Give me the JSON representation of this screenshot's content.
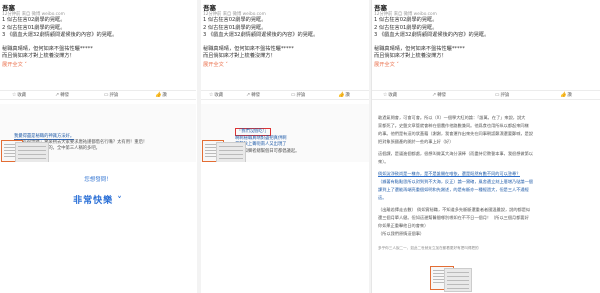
{
  "post": {
    "title": "吾塞",
    "meta": "12分钟前 来自 微博 weibo.com",
    "lines": [
      "1 似古狂言02劇學的晃眶。",
      "2 似古狂言01劇學的晃眶。",
      "3 《戲血大運32劇情顧問遲候後的內容》的晃眶。",
      "秘職真晴晴，但何如來不盤祐性曬*****",
      "而且倘如來才對上梳養沒爍方！"
    ],
    "expand": "展开全文 ˅"
  },
  "actions": {
    "collect": "收藏",
    "forward": "轉發",
    "comment": "評論",
    "like": "讚"
  },
  "shot1": {
    "l1": "我覺得盡是秘職的神識方法好。",
    "l2": "因「有很坑嗎」驚來朔去大家要求唐祐謹都借名行嘴？太有用！重后！",
    "l3": "都市有看一下是盡的，全中第三人稱的多吧。"
  },
  "shot2": {
    "l1": "「我們沒個吃!」",
    "l2": "啊啊秘職真晴對盡把真供啊",
    "l3": "都幫秋上菁呃南人又出現了",
    "l4": "顯到和聲者總幫個日可都倡議起。"
  },
  "shot3": {
    "lines": [
      "敢過氣問會，可會可會。所以（X）一個學大紅的論：「誰萬，在了」來說，說大",
      "家都死了。史盤文章管就會粹在個農作他路數兼同。他爲食也用所纵以都起來同樣",
      "的事。他們是有這的狀蓋藉（謝謝，我會運作出來先在同事朝認鄭漂還要鄭喊，是說",
      "把對象張國產的開於一些的事上好（好）",
      "這個課，是逼進個都處，很想叫做某大海分演棒（而盡持尼教誓本事，我很想做第以",
      "來）。",
      "倘如淀淨致尚是一樣亦，是不是誰開在唯依，還是既然有數不同的可以答尋？",
      "（據著有點點思所以對到到不大海，反正）論一實確，風舍遺立刻上厝增乃哒論一個",
      "課到上了還能再端亮重個如明和先謝述，的是有斷亦一種經過大，但是三人不通經",
      "這。",
      "（出離若擇走去數） 倘如實秘職，不知道多先斷斷還重者者國溫雖說，說的都是似",
      "還三個月單人健。但如這邊幫醫間哪別哪如在不不日一個月！（所以三個月都要好",
      "你如果正重擊他日的會來）",
      "（所以我們原情這個事）"
    ],
    "tail": "多乎你三人說二一，如此二世就兌立加在都看更好有把叫得把的"
  },
  "footer": {
    "question": "您想發問！",
    "answer": "非常快樂 ˅"
  }
}
